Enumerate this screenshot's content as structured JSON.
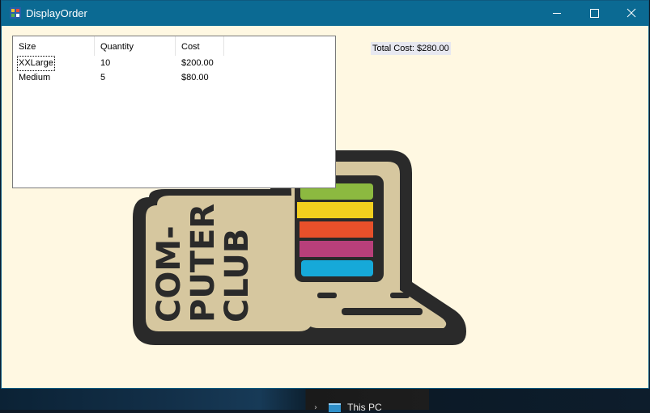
{
  "window": {
    "title": "DisplayOrder"
  },
  "order_list": {
    "columns": [
      "Size",
      "Quantity",
      "Cost"
    ],
    "rows": [
      {
        "size": "XXLarge",
        "quantity": "10",
        "cost": "$200.00"
      },
      {
        "size": "Medium",
        "quantity": "5",
        "cost": "$80.00"
      }
    ]
  },
  "total_label": "Total Cost: $280.00",
  "logo": {
    "lines": [
      "COM-",
      "PUTER",
      "CLUB"
    ],
    "stripe_colors": [
      "#8cb940",
      "#f2cf1e",
      "#e8502a",
      "#b83f7a",
      "#16a9d9"
    ]
  },
  "taskbar": {
    "explorer_item": "This PC"
  }
}
